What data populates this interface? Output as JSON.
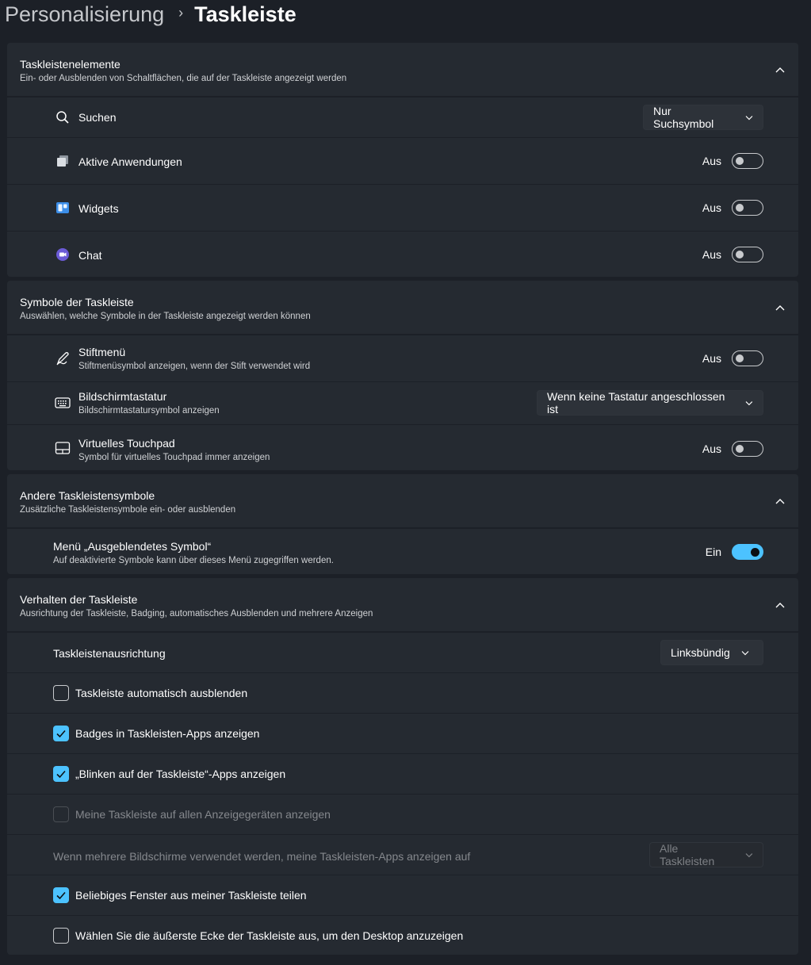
{
  "breadcrumb": {
    "parent": "Personalisierung",
    "separator": "›",
    "current": "Taskleiste"
  },
  "sections": {
    "elements": {
      "title": "Taskleistenelemente",
      "subtitle": "Ein- oder Ausblenden von Schaltflächen, die auf der Taskleiste angezeigt werden",
      "search": {
        "label": "Suchen",
        "dropdown": "Nur Suchsymbol",
        "icon": "search-icon"
      },
      "active_apps": {
        "label": "Aktive Anwendungen",
        "state": "Aus",
        "on": false,
        "icon": "task-view-icon"
      },
      "widgets": {
        "label": "Widgets",
        "state": "Aus",
        "on": false,
        "icon": "widgets-icon"
      },
      "chat": {
        "label": "Chat",
        "state": "Aus",
        "on": false,
        "icon": "chat-icon"
      }
    },
    "symbols": {
      "title": "Symbole der Taskleiste",
      "subtitle": "Auswählen, welche Symbole in der Taskleiste angezeigt werden können",
      "pen": {
        "label": "Stiftmenü",
        "desc": "Stiftmenüsymbol anzeigen, wenn der Stift verwendet wird",
        "state": "Aus",
        "on": false,
        "icon": "pen-icon"
      },
      "keyboard": {
        "label": "Bildschirmtastatur",
        "desc": "Bildschirmtastatursymbol anzeigen",
        "dropdown": "Wenn keine Tastatur angeschlossen ist",
        "icon": "keyboard-icon"
      },
      "touchpad": {
        "label": "Virtuelles Touchpad",
        "desc": "Symbol für virtuelles Touchpad immer anzeigen",
        "state": "Aus",
        "on": false,
        "icon": "touchpad-icon"
      }
    },
    "other": {
      "title": "Andere Taskleistensymbole",
      "subtitle": "Zusätzliche Taskleistensymbole ein- oder ausblenden",
      "hidden_menu": {
        "label": "Menü „Ausgeblendetes Symbol“",
        "desc": "Auf deaktivierte Symbole kann über dieses Menü zugegriffen werden.",
        "state": "Ein",
        "on": true
      }
    },
    "behavior": {
      "title": "Verhalten der Taskleiste",
      "subtitle": "Ausrichtung der Taskleiste, Badging, automatisches Ausblenden und mehrere Anzeigen",
      "alignment": {
        "label": "Taskleistenausrichtung",
        "dropdown": "Linksbündig"
      },
      "autohide": {
        "label": "Taskleiste automatisch ausblenden",
        "checked": false
      },
      "badges": {
        "label": "Badges in Taskleisten-Apps anzeigen",
        "checked": true
      },
      "flashing": {
        "label": "„Blinken auf der Taskleiste“-Apps anzeigen",
        "checked": true
      },
      "all_displays": {
        "label": "Meine Taskleiste auf allen Anzeigegeräten anzeigen",
        "checked": false,
        "disabled": true
      },
      "multi_monitor": {
        "label": "Wenn mehrere Bildschirme verwendet werden, meine Taskleisten-Apps anzeigen auf",
        "dropdown": "Alle Taskleisten",
        "disabled": true
      },
      "share_window": {
        "label": "Beliebiges Fenster aus meiner Taskleiste teilen",
        "checked": true
      },
      "corner_desktop": {
        "label": "Wählen Sie die äußerste Ecke der Taskleiste aus, um den Desktop anzuzeigen",
        "checked": false
      }
    }
  },
  "colors": {
    "accent": "#4cc2ff",
    "background": "#1c2027",
    "card": "#252a31"
  }
}
